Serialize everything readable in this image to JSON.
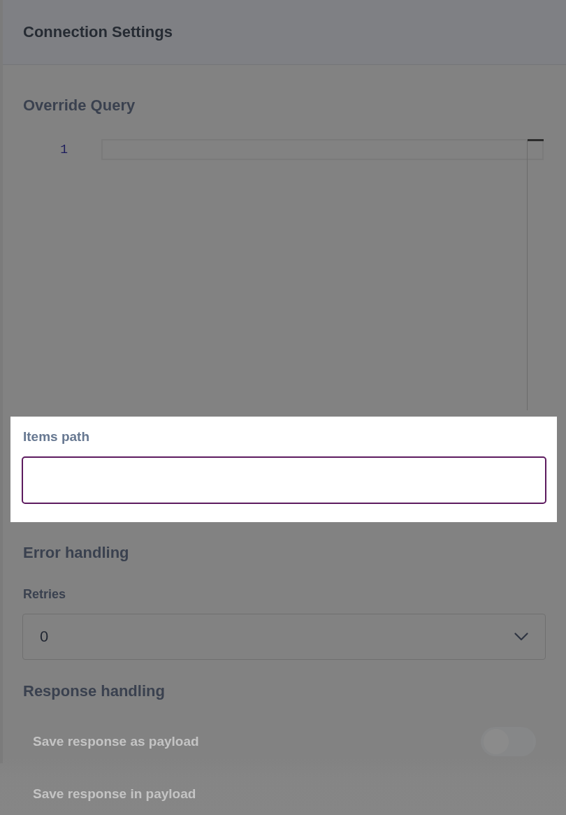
{
  "header": {
    "title": "Connection Settings"
  },
  "sections": [
    {
      "kind": "code_editor",
      "heading": "Override Query",
      "line_numbers": [
        "1"
      ]
    },
    {
      "kind": "text_field",
      "label": "Items path",
      "focused": true,
      "spotlight": true
    },
    {
      "kind": "select",
      "heading": "Error handling",
      "label": "Retries",
      "value": "0"
    },
    {
      "kind": "toggle_list",
      "heading": "Response handling",
      "items": [
        {
          "kind": "toggle",
          "label": "Save response as payload",
          "on": false,
          "disabled": true
        },
        {
          "kind": "text",
          "label": "Save response in payload",
          "disabled": true
        }
      ]
    }
  ]
}
